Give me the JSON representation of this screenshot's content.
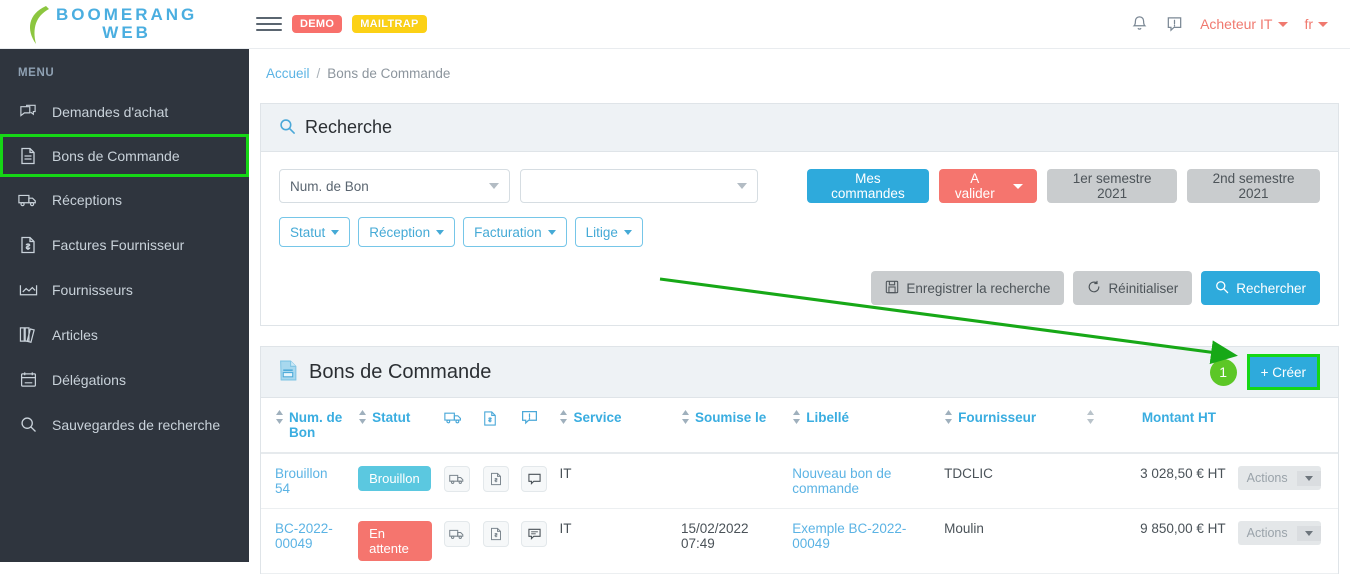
{
  "topbar": {
    "logo_line1": "BOOMERANG",
    "logo_line2": "WEB",
    "badges": [
      "DEMO",
      "MAILTRAP"
    ],
    "badge_demo": "DEMO",
    "badge_mailtrap": "MAILTRAP",
    "user": "Acheteur IT",
    "lang": "fr",
    "icons": [
      "bell-icon",
      "alert-message-icon",
      "hamburger-menu-icon"
    ]
  },
  "sidebar": {
    "title": "MENU",
    "items": [
      {
        "label": "Demandes d'achat",
        "icon": "chat-bubbles-icon",
        "active": false
      },
      {
        "label": "Bons de Commande",
        "icon": "document-lines-icon",
        "active": true
      },
      {
        "label": "Réceptions",
        "icon": "truck-icon",
        "active": false
      },
      {
        "label": "Factures Fournisseur",
        "icon": "invoice-icon",
        "active": false
      },
      {
        "label": "Fournisseurs",
        "icon": "chart-icon",
        "active": false
      },
      {
        "label": "Articles",
        "icon": "books-icon",
        "active": false
      },
      {
        "label": "Délégations",
        "icon": "calendar-icon",
        "active": false
      },
      {
        "label": "Sauvegardes de recherche",
        "icon": "search-icon",
        "active": false
      }
    ]
  },
  "breadcrumb": {
    "home": "Accueil",
    "separator": "/",
    "current": "Bons de Commande"
  },
  "search_panel": {
    "title": "Recherche",
    "icon": "magnifier-icon",
    "field_select": {
      "value": "Num. de Bon",
      "placeholder": "Num. de Bon"
    },
    "value_select": {
      "value": "",
      "placeholder": ""
    },
    "quick_buttons": [
      {
        "label": "Mes commandes",
        "style": "blue",
        "caret": false
      },
      {
        "label": "A valider",
        "style": "red",
        "caret": true
      },
      {
        "label": "1er semestre 2021",
        "style": "grey",
        "caret": false
      },
      {
        "label": "2nd semestre 2021",
        "style": "grey",
        "caret": false
      }
    ],
    "filter_buttons": [
      {
        "label": "Statut"
      },
      {
        "label": "Réception"
      },
      {
        "label": "Facturation"
      },
      {
        "label": "Litige"
      }
    ],
    "actions": [
      {
        "label": "Enregistrer la recherche",
        "style": "grey",
        "icon": "save-icon"
      },
      {
        "label": "Réinitialiser",
        "style": "grey",
        "icon": "reset-icon"
      },
      {
        "label": "Rechercher",
        "style": "blue",
        "icon": "search-icon"
      }
    ]
  },
  "list_panel": {
    "title": "Bons de Commande",
    "icon": "document-icon",
    "step_badge": "1",
    "create_button": "+ Créer",
    "columns": [
      {
        "label": "Num. de Bon",
        "sortable": true,
        "icon": null
      },
      {
        "label": "Statut",
        "sortable": true,
        "icon": null
      },
      {
        "label": "",
        "sortable": false,
        "icon": "truck-icon"
      },
      {
        "label": "",
        "sortable": false,
        "icon": "invoice-icon"
      },
      {
        "label": "",
        "sortable": false,
        "icon": "comment-icon"
      },
      {
        "label": "Service",
        "sortable": true,
        "icon": null
      },
      {
        "label": "Soumise le",
        "sortable": true,
        "icon": null
      },
      {
        "label": "Libellé",
        "sortable": true,
        "icon": null
      },
      {
        "label": "Fournisseur",
        "sortable": true,
        "icon": null
      },
      {
        "label": "Montant HT",
        "sortable": true,
        "icon": null
      }
    ],
    "rows": [
      {
        "num": "Brouillon 54",
        "statut": "Brouillon",
        "statut_style": "brouillon",
        "service": "IT",
        "soumise_le": "",
        "libelle": "Nouveau bon de commande",
        "fournisseur": "TDCLIC",
        "montant": "3 028,50 € HT",
        "actions_label": "Actions"
      },
      {
        "num": "BC-2022-00049",
        "statut": "En attente",
        "statut_style": "attente",
        "service": "IT",
        "soumise_le": "15/02/2022 07:49",
        "libelle": "Exemple BC-2022-00049",
        "fournisseur": "Moulin",
        "montant": "9 850,00 € HT",
        "actions_label": "Actions"
      }
    ]
  },
  "annotation": {
    "arrow_color": "#16a916",
    "highlight_color": "#16d716",
    "step_number": "1"
  },
  "colors": {
    "brand_blue": "#2eaadc",
    "brand_red": "#f5756e",
    "sidebar_bg": "#2f353e",
    "panel_head": "#eef2f5",
    "link": "#5bb3e4"
  }
}
